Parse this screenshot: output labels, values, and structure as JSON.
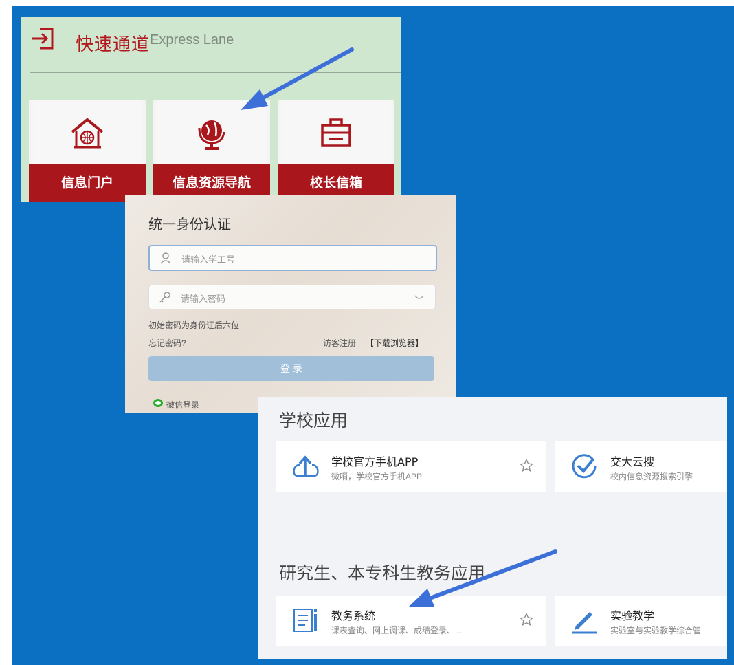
{
  "express_lane": {
    "title_cn": "快速通道",
    "title_en": "Express Lane",
    "tiles": [
      {
        "label": "信息门户",
        "icon": "house-globe-icon"
      },
      {
        "label": "信息资源导航",
        "icon": "globe-stand-icon"
      },
      {
        "label": "校长信箱",
        "icon": "toolbox-icon"
      }
    ]
  },
  "login": {
    "title": "统一身份认证",
    "username_placeholder": "请输入学工号",
    "password_placeholder": "请输入密码",
    "hint": "初始密码为身份证后六位",
    "forgot": "忘记密码?",
    "visitor_register": "访客注册",
    "download_browser": "【下载浏览器】",
    "login_button": "登 录",
    "wechat_login": "微信登录"
  },
  "apps": {
    "section1_title": "学校应用",
    "section1_cards": [
      {
        "name": "学校官方手机APP",
        "desc": "微哨，学校官方手机APP",
        "icon": "cloud-upload-icon"
      },
      {
        "name": "交大云搜",
        "desc": "校内信息资源搜索引擎",
        "icon": "check-circle-icon"
      }
    ],
    "section2_title": "研究生、本专科生教务应用",
    "section2_cards": [
      {
        "name": "教务系统",
        "desc": "课表查询、网上调课、成绩登录、...",
        "icon": "document-icon"
      },
      {
        "name": "实验教学",
        "desc": "实验室与实验教学综合管",
        "icon": "pen-icon"
      }
    ]
  },
  "colors": {
    "background_blue": "#0b70c1",
    "brand_red": "#a9161c",
    "express_bg": "#cfe6cf",
    "icon_blue": "#3b7fd0",
    "arrow_blue": "#3d6fd8"
  }
}
